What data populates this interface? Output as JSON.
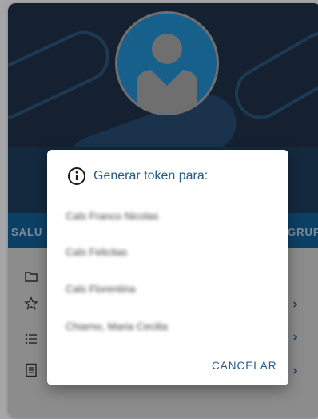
{
  "card": {
    "nav_left": "SALU",
    "nav_right": "GRUPO"
  },
  "icons": {
    "folder": "folder-icon",
    "star": "star-icon",
    "list": "list-icon",
    "document": "document-icon",
    "chevron": "chevron-right-icon",
    "chevron_glyph": "›"
  },
  "dialog": {
    "title": "Generar token para:",
    "options": [
      "Cals Franco Nicolas",
      "Cals Felicitas",
      "Cals Florentina",
      "Chiarno, Maria Cecilia"
    ],
    "cancel_label": "CANCELAR"
  },
  "colors": {
    "accent": "#1f5a8f",
    "header": "#1e2f44",
    "strip": "#13598d"
  }
}
